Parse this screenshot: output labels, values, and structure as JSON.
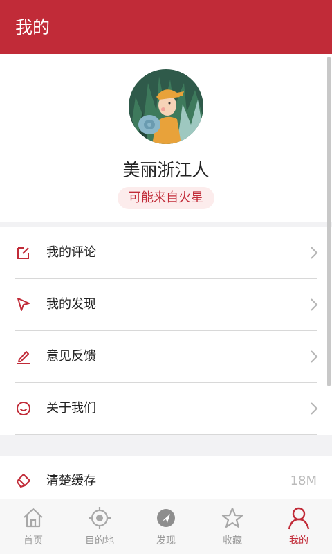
{
  "header": {
    "title": "我的"
  },
  "profile": {
    "nickname": "美丽浙江人",
    "tagline": "可能来自火星"
  },
  "menu": {
    "items": [
      {
        "label": "我的评论",
        "icon": "edit-square-icon"
      },
      {
        "label": "我的发现",
        "icon": "cursor-arrow-icon"
      },
      {
        "label": "意见反馈",
        "icon": "pencil-icon"
      },
      {
        "label": "关于我们",
        "icon": "smile-icon"
      }
    ]
  },
  "cache": {
    "label": "清楚缓存",
    "value": "18M",
    "icon": "eraser-icon"
  },
  "tabbar": {
    "tabs": [
      {
        "label": "首页",
        "icon": "home-icon",
        "active": false
      },
      {
        "label": "目的地",
        "icon": "target-icon",
        "active": false
      },
      {
        "label": "发现",
        "icon": "compass-icon",
        "active": false
      },
      {
        "label": "收藏",
        "icon": "star-icon",
        "active": false
      },
      {
        "label": "我的",
        "icon": "person-icon",
        "active": true
      }
    ]
  },
  "colors": {
    "accent": "#c12b38",
    "inactive": "#9a9a9a",
    "background": "#f2f2f4"
  }
}
